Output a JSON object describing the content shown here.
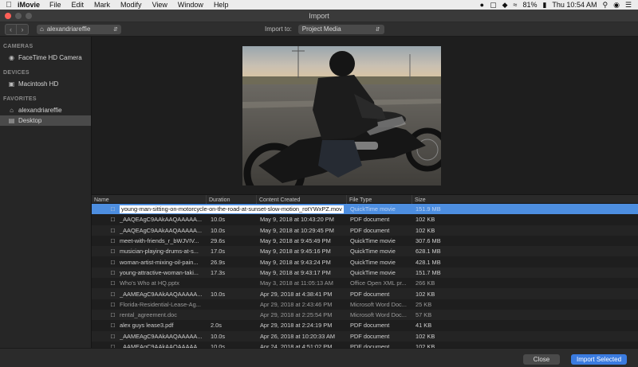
{
  "menubar": {
    "app_name": "iMovie",
    "menus": [
      "File",
      "Edit",
      "Mark",
      "Modify",
      "View",
      "Window",
      "Help"
    ],
    "battery": "81%",
    "clock": "Thu 10:54 AM"
  },
  "window": {
    "title": "Import"
  },
  "toolbar": {
    "location": "alexandriareffie",
    "import_to_label": "Import to:",
    "import_to_value": "Project Media"
  },
  "sidebar": {
    "sections": [
      {
        "title": "CAMERAS",
        "items": [
          {
            "label": "FaceTime HD Camera",
            "icon": "camera-icon"
          }
        ]
      },
      {
        "title": "DEVICES",
        "items": [
          {
            "label": "Macintosh HD",
            "icon": "drive-icon"
          }
        ]
      },
      {
        "title": "FAVORITES",
        "items": [
          {
            "label": "alexandriareffie",
            "icon": "home-icon"
          },
          {
            "label": "Desktop",
            "icon": "folder-icon",
            "selected": true
          }
        ]
      }
    ]
  },
  "table": {
    "columns": [
      "Name",
      "Duration",
      "Content Created",
      "File Type",
      "Size"
    ],
    "rows": [
      {
        "name": "young-man-sitting-on-motorcycle-on-the-road-at-sunset-slow-motion_rotYWxPZ.mov",
        "duration": "",
        "created": "",
        "type": "QuickTime movie",
        "size": "151.9 MB",
        "selected": true
      },
      {
        "name": "_AAQEAgC9AAkAAQAAAAA...",
        "duration": "10.0s",
        "created": "May 9, 2018 at 10:43:20 PM",
        "type": "PDF document",
        "size": "102 KB"
      },
      {
        "name": "_AAQEAgC9AAkAAQAAAAA...",
        "duration": "10.0s",
        "created": "May 9, 2018 at 10:29:45 PM",
        "type": "PDF document",
        "size": "102 KB"
      },
      {
        "name": "meet-with-friends_r_bWJVIV...",
        "duration": "29.6s",
        "created": "May 9, 2018 at 9:45:49 PM",
        "type": "QuickTime movie",
        "size": "307.6 MB"
      },
      {
        "name": "musician-playing-drums-at-s...",
        "duration": "17.0s",
        "created": "May 9, 2018 at 9:45:16 PM",
        "type": "QuickTime movie",
        "size": "628.1 MB"
      },
      {
        "name": "woman-artist-mixing-oil-pain...",
        "duration": "26.9s",
        "created": "May 9, 2018 at 9:43:24 PM",
        "type": "QuickTime movie",
        "size": "428.1 MB"
      },
      {
        "name": "young-attractive-woman-taki...",
        "duration": "17.3s",
        "created": "May 9, 2018 at 9:43:17 PM",
        "type": "QuickTime movie",
        "size": "151.7 MB"
      },
      {
        "name": "Who's Who at HQ.pptx",
        "duration": "",
        "created": "May 3, 2018 at 11:05:13 AM",
        "type": "Office Open XML pr...",
        "size": "266 KB",
        "dim": true
      },
      {
        "name": "_AAMEAgC9AAkAAQAAAAA...",
        "duration": "10.0s",
        "created": "Apr 29, 2018 at 4:38:41 PM",
        "type": "PDF document",
        "size": "102 KB"
      },
      {
        "name": "Florida-Residential-Lease-Ag...",
        "duration": "",
        "created": "Apr 29, 2018 at 2:43:46 PM",
        "type": "Microsoft Word Doc...",
        "size": "25 KB",
        "dim": true
      },
      {
        "name": "rental_agreement.doc",
        "duration": "",
        "created": "Apr 29, 2018 at 2:25:54 PM",
        "type": "Microsoft Word Doc...",
        "size": "57 KB",
        "dim": true
      },
      {
        "name": "alex guys lease3.pdf",
        "duration": "2.0s",
        "created": "Apr 29, 2018 at 2:24:19 PM",
        "type": "PDF document",
        "size": "41 KB"
      },
      {
        "name": "_AAMEAgC9AAkAAQAAAAA...",
        "duration": "10.0s",
        "created": "Apr 26, 2018 at 10:20:33 AM",
        "type": "PDF document",
        "size": "102 KB"
      },
      {
        "name": "_AAMEAgC9AAkAAQAAAAA...",
        "duration": "10.0s",
        "created": "Apr 24, 2018 at 4:51:02 PM",
        "type": "PDF document",
        "size": "102 KB"
      }
    ]
  },
  "buttons": {
    "close": "Close",
    "import": "Import Selected"
  }
}
